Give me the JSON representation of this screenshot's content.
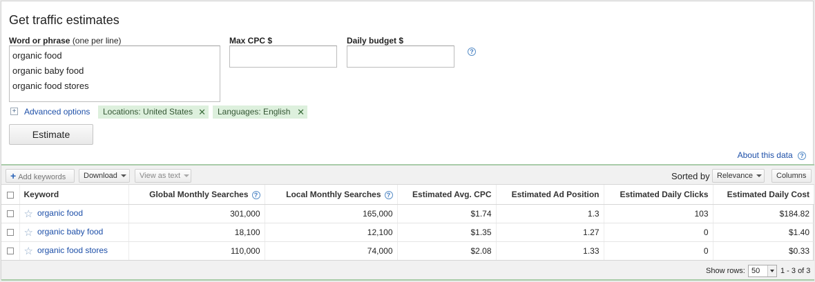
{
  "title": "Get traffic estimates",
  "form": {
    "word_label": "Word or phrase",
    "word_hint": "(one per line)",
    "keywords_text": [
      "organic food",
      "organic baby food",
      "organic food stores"
    ],
    "max_cpc_label": "Max CPC $",
    "max_cpc_value": "",
    "daily_budget_label": "Daily budget $",
    "daily_budget_value": "",
    "help_glyph": "?",
    "advanced_toggle": "+",
    "advanced_label": "Advanced options",
    "chips": [
      {
        "label": "Locations: United States",
        "remove": "✕"
      },
      {
        "label": "Languages: English",
        "remove": "✕"
      }
    ],
    "estimate_button": "Estimate"
  },
  "about_link": "About this data",
  "toolbar": {
    "add_keywords": "Add keywords",
    "download": "Download",
    "view_as_text": "View as text",
    "sorted_by_label": "Sorted by",
    "sort_value": "Relevance",
    "columns": "Columns"
  },
  "table": {
    "headers": {
      "keyword": "Keyword",
      "global": "Global Monthly Searches",
      "local": "Local Monthly Searches",
      "cpc": "Estimated Avg. CPC",
      "position": "Estimated Ad Position",
      "clicks": "Estimated Daily Clicks",
      "cost": "Estimated Daily Cost"
    },
    "rows": [
      {
        "keyword": "organic food",
        "global": "301,000",
        "local": "165,000",
        "cpc": "$1.74",
        "position": "1.3",
        "clicks": "103",
        "cost": "$184.82"
      },
      {
        "keyword": "organic baby food",
        "global": "18,100",
        "local": "12,100",
        "cpc": "$1.35",
        "position": "1.27",
        "clicks": "0",
        "cost": "$1.40"
      },
      {
        "keyword": "organic food stores",
        "global": "110,000",
        "local": "74,000",
        "cpc": "$2.08",
        "position": "1.33",
        "clicks": "0",
        "cost": "$0.33"
      }
    ]
  },
  "footer": {
    "show_rows_label": "Show rows:",
    "rows_value": "50",
    "range": "1 - 3 of 3"
  },
  "colors": {
    "link": "#1d4fa8",
    "chip_bg": "#ddf0dd",
    "accent_border": "#a8cba8"
  }
}
